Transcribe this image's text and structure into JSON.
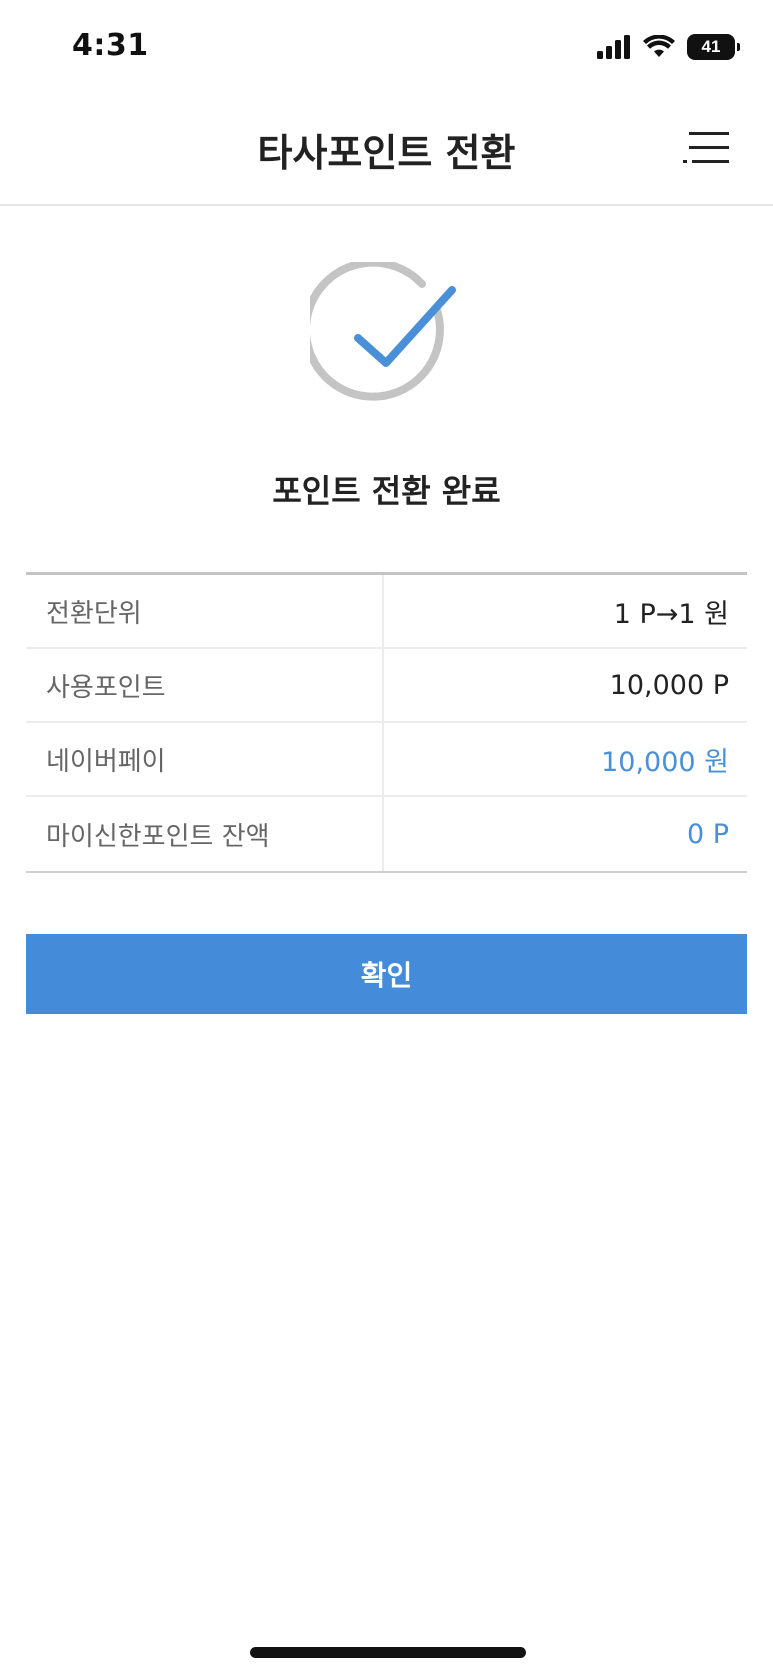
{
  "status_bar": {
    "time": "4:31",
    "battery_level": "41",
    "icons": [
      "signal-icon",
      "wifi-icon",
      "battery-icon"
    ]
  },
  "header": {
    "title": "타사포인트 전환",
    "menu_icon": "hamburger-menu-icon"
  },
  "result": {
    "icon": "check-circle-icon",
    "title": "포인트 전환 완료"
  },
  "details": {
    "rows": [
      {
        "label": "전환단위",
        "value": "1 P→1 원",
        "highlight": false
      },
      {
        "label": "사용포인트",
        "value": "10,000 P",
        "highlight": false
      },
      {
        "label": "네이버페이",
        "value": "10,000 원",
        "highlight": true
      },
      {
        "label": "마이신한포인트 잔액",
        "value": "0 P",
        "highlight": true
      }
    ]
  },
  "actions": {
    "confirm_label": "확인"
  },
  "colors": {
    "accent": "#448bd9",
    "value_highlight": "#4a8fd8",
    "check_ring": "#c4c4c4",
    "text_primary": "#222222",
    "text_label": "#666666"
  }
}
